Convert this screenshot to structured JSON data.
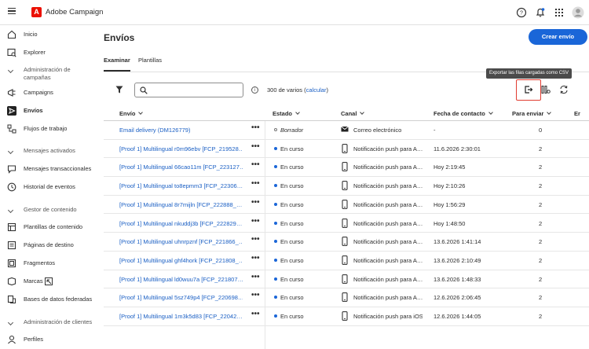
{
  "app": {
    "title": "Adobe Campaign"
  },
  "sidebar": {
    "items": [
      {
        "label": "Inicio",
        "icon": "home-icon"
      },
      {
        "label": "Explorer",
        "icon": "explorer-icon"
      }
    ],
    "sections": [
      {
        "label": "Administración de campañas"
      },
      {
        "label": "Mensajes activados"
      },
      {
        "label": "Gestor de contenido"
      },
      {
        "label": "Administración de clientes"
      }
    ],
    "campaign_items": [
      {
        "label": "Campaigns"
      },
      {
        "label": "Envíos"
      },
      {
        "label": "Flujos de trabajo"
      }
    ],
    "triggered_items": [
      {
        "label": "Mensajes transaccionales"
      },
      {
        "label": "Historial de eventos"
      }
    ],
    "content_items": [
      {
        "label": "Plantillas de contenido"
      },
      {
        "label": "Páginas de destino"
      },
      {
        "label": "Fragmentos"
      },
      {
        "label": "Marcas"
      },
      {
        "label": "Bases de datos federadas"
      }
    ],
    "customer_items": [
      {
        "label": "Perfiles"
      }
    ]
  },
  "main": {
    "title": "Envíos",
    "create_button": "Crear envío",
    "tabs": [
      {
        "label": "Examinar"
      },
      {
        "label": "Plantillas"
      }
    ],
    "search": {
      "placeholder": ""
    },
    "count_text": "300 de varios (",
    "count_link": "calcular",
    "count_end": ")",
    "tooltip": "Exportar las filas cargadas como CSV"
  },
  "table": {
    "headers": {
      "name": "Envío",
      "status": "Estado",
      "channel": "Canal",
      "date": "Fecha de contacto",
      "to_send": "Para enviar",
      "extra": "Er"
    },
    "rows": [
      {
        "name": "Email delivery (DM126779)",
        "status": "Borrador",
        "channel": "Correo electrónico",
        "date": "-",
        "to_send": "0"
      },
      {
        "name": "[Proof 1] Multilingual r0m96ebv [FCP_219528…",
        "status": "En curso",
        "channel": "Notificación push para A…",
        "date": "11.6.2026 2:30:01",
        "to_send": "2"
      },
      {
        "name": "[Proof 1] Multilingual 66cao11m [FCP_223127…",
        "status": "En curso",
        "channel": "Notificación push para A…",
        "date": "Hoy 2:19:45",
        "to_send": "2"
      },
      {
        "name": "[Proof 1] Multilingual to8epmm3 [FCP_22306…",
        "status": "En curso",
        "channel": "Notificación push para A…",
        "date": "Hoy 2:10:26",
        "to_send": "2"
      },
      {
        "name": "[Proof 1] Multilingual 8r7mijln [FCP_222888_…",
        "status": "En curso",
        "channel": "Notificación push para A…",
        "date": "Hoy 1:56:29",
        "to_send": "2"
      },
      {
        "name": "[Proof 1] Multilingual nkuddj3b [FCP_222829…",
        "status": "En curso",
        "channel": "Notificación push para A…",
        "date": "Hoy 1:48:50",
        "to_send": "2"
      },
      {
        "name": "[Proof 1] Multilingual uhnrpznf [FCP_221866_…",
        "status": "En curso",
        "channel": "Notificación push para A…",
        "date": "13.6.2026 1:41:14",
        "to_send": "2"
      },
      {
        "name": "[Proof 1] Multilingual ghf4hork [FCP_221808_…",
        "status": "En curso",
        "channel": "Notificación push para A…",
        "date": "13.6.2026 2:10:49",
        "to_send": "2"
      },
      {
        "name": "[Proof 1] Multilingual ld0wuu7a [FCP_221807…",
        "status": "En curso",
        "channel": "Notificación push para A…",
        "date": "13.6.2026 1:48:33",
        "to_send": "2"
      },
      {
        "name": "[Proof 1] Multilingual 5sz749p4 [FCP_220698…",
        "status": "En curso",
        "channel": "Notificación push para A…",
        "date": "12.6.2026 2:06:45",
        "to_send": "2"
      },
      {
        "name": "[Proof 1] Multilingual 1m3k5d83 [FCP_22042…",
        "status": "En curso",
        "channel": "Notificación push para iOS",
        "date": "12.6.2026 1:44:05",
        "to_send": "2"
      }
    ]
  },
  "colors": {
    "accent": "#1a66d8",
    "brand": "#eb1000",
    "highlight": "#e03c31"
  }
}
